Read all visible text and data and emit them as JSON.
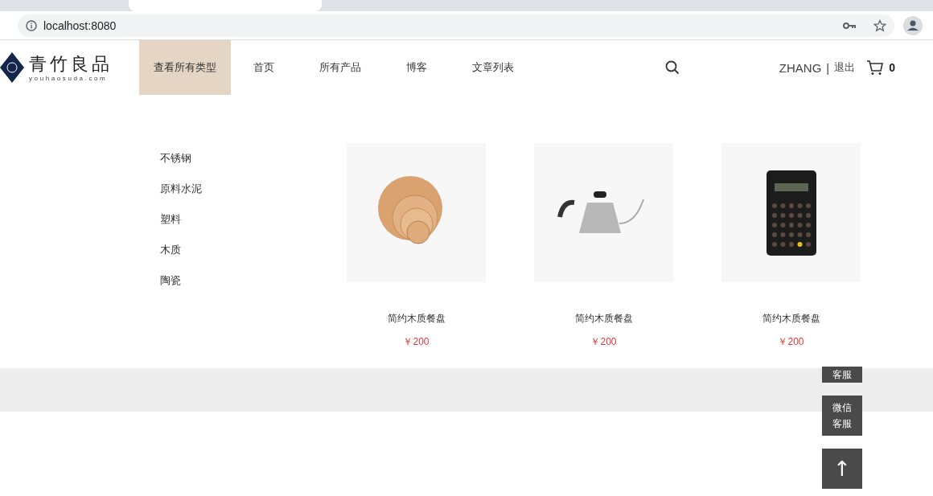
{
  "browser": {
    "url": "localhost:8080"
  },
  "header": {
    "logo": {
      "name": "青竹良品",
      "domain": "youhaosuda.com"
    },
    "nav": [
      {
        "label": "查看所有类型",
        "selected": true
      },
      {
        "label": "首页",
        "selected": false
      },
      {
        "label": "所有产品",
        "selected": false
      },
      {
        "label": "博客",
        "selected": false
      },
      {
        "label": "文章列表",
        "selected": false
      }
    ],
    "user": "ZHANG",
    "separator": "|",
    "logout": "退出",
    "cart_count": "0"
  },
  "dropdown": {
    "categories": [
      "不锈钢",
      "原料水泥",
      "塑料",
      "木质",
      "陶瓷"
    ],
    "products": [
      {
        "name": "简约木质餐盘",
        "price": "￥200",
        "kind": "plates"
      },
      {
        "name": "简约木质餐盘",
        "price": "￥200",
        "kind": "kettle"
      },
      {
        "name": "简约木质餐盘",
        "price": "￥200",
        "kind": "calculator"
      }
    ]
  },
  "side_buttons": [
    {
      "kind": "text",
      "lines": [
        "客服"
      ]
    },
    {
      "kind": "text",
      "lines": [
        "微信",
        "客服"
      ]
    },
    {
      "kind": "glyph",
      "lines": [
        "↑"
      ]
    }
  ]
}
